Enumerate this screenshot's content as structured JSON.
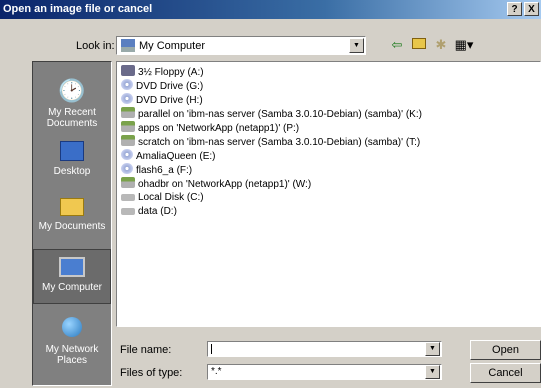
{
  "dialog": {
    "title": "Open an image file or cancel",
    "help_label": "?",
    "close_label": "X"
  },
  "toolbar": {
    "look_in_label": "Look in:",
    "look_in_value": "My Computer",
    "back_icon": "back-arrow-icon",
    "up_icon": "up-folder-icon",
    "new_folder_icon": "new-folder-icon",
    "views_icon": "views-menu-icon"
  },
  "places": [
    {
      "label": "My Recent Documents",
      "icon": "recent-documents-icon"
    },
    {
      "label": "Desktop",
      "icon": "desktop-icon"
    },
    {
      "label": "My Documents",
      "icon": "my-documents-icon"
    },
    {
      "label": "My Computer",
      "icon": "my-computer-icon",
      "selected": true
    },
    {
      "label": "My Network Places",
      "icon": "network-places-icon"
    }
  ],
  "files": [
    {
      "name": "3½ Floppy (A:)",
      "icon": "floppy"
    },
    {
      "name": "DVD Drive (G:)",
      "icon": "dvd"
    },
    {
      "name": "DVD Drive (H:)",
      "icon": "dvd"
    },
    {
      "name": "parallel on 'ibm-nas server (Samba 3.0.10-Debian) (samba)' (K:)",
      "icon": "net"
    },
    {
      "name": "apps on 'NetworkApp (netapp1)' (P:)",
      "icon": "net"
    },
    {
      "name": "scratch on 'ibm-nas server (Samba 3.0.10-Debian) (samba)' (T:)",
      "icon": "net"
    },
    {
      "name": "AmaliaQueen (E:)",
      "icon": "dvd"
    },
    {
      "name": "flash6_a (F:)",
      "icon": "dvd"
    },
    {
      "name": "ohadbr on 'NetworkApp (netapp1)' (W:)",
      "icon": "net"
    },
    {
      "name": "Local Disk (C:)",
      "icon": "disk"
    },
    {
      "name": "data (D:)",
      "icon": "disk"
    }
  ],
  "form": {
    "file_name_label": "File name:",
    "file_name_value": "",
    "files_of_type_label": "Files of type:",
    "files_of_type_value": "*.*",
    "open_label": "Open",
    "cancel_label": "Cancel"
  }
}
